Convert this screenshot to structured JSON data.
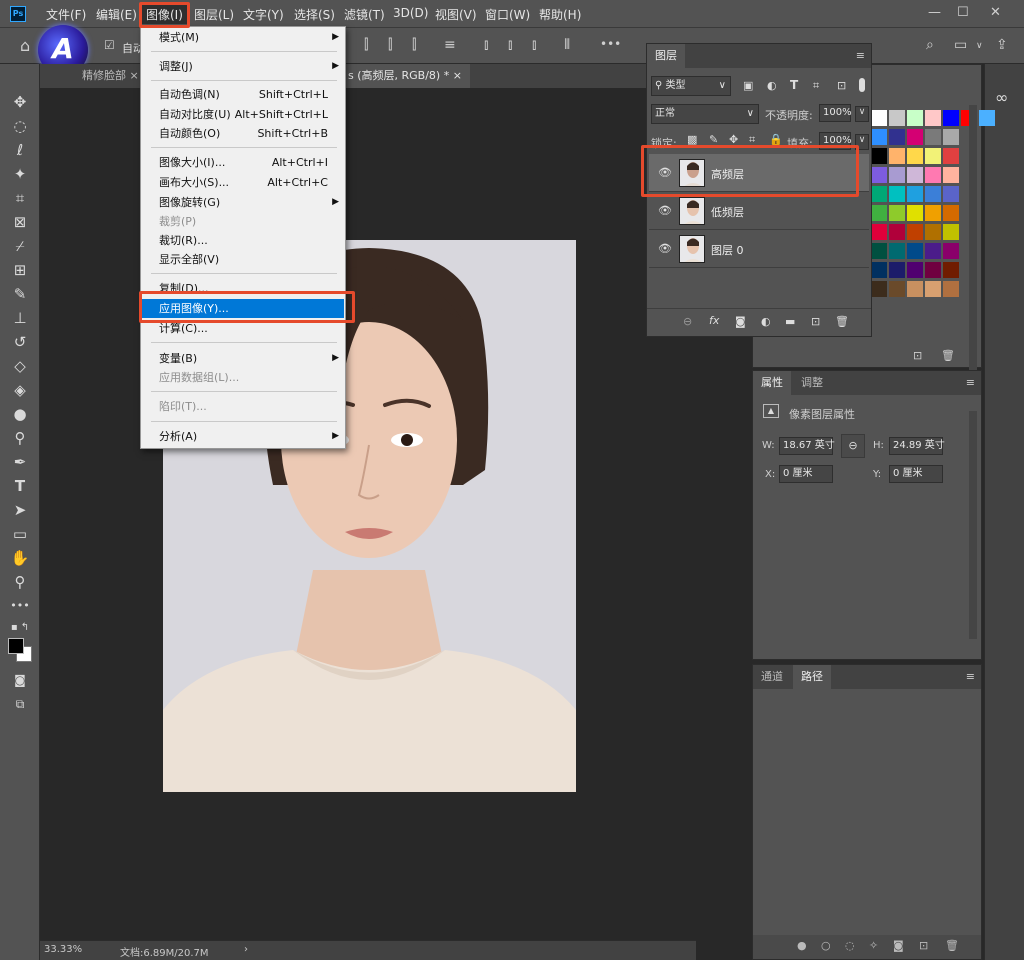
{
  "app": {
    "logo": "Ps",
    "avatar_letter": "A"
  },
  "menubar": {
    "items": [
      "文件(F)",
      "编辑(E)",
      "图像(I)",
      "图层(L)",
      "文字(Y)",
      "选择(S)",
      "滤镜(T)",
      "3D(D)",
      "视图(V)",
      "窗口(W)",
      "帮助(H)"
    ],
    "active": "图像(I)",
    "window_controls": [
      "—",
      "☐",
      "✕"
    ]
  },
  "options_bar": {
    "auto_select_label": "自动"
  },
  "tabs": [
    {
      "label": "精修脸部 ×",
      "active": false
    },
    {
      "label": "s (高频层, RGB/8) *  ×",
      "active": true
    }
  ],
  "image_menu": {
    "items": [
      {
        "label": "模式(M)",
        "shortcut": "",
        "submenu": true,
        "disabled": false
      },
      {
        "label": "调整(J)",
        "shortcut": "",
        "submenu": true,
        "disabled": false
      },
      {
        "label": "自动色调(N)",
        "shortcut": "Shift+Ctrl+L",
        "submenu": false,
        "disabled": false
      },
      {
        "label": "自动对比度(U)",
        "shortcut": "Alt+Shift+Ctrl+L",
        "submenu": false,
        "disabled": false
      },
      {
        "label": "自动颜色(O)",
        "shortcut": "Shift+Ctrl+B",
        "submenu": false,
        "disabled": false
      },
      {
        "label": "图像大小(I)...",
        "shortcut": "Alt+Ctrl+I",
        "submenu": false,
        "disabled": false
      },
      {
        "label": "画布大小(S)...",
        "shortcut": "Alt+Ctrl+C",
        "submenu": false,
        "disabled": false
      },
      {
        "label": "图像旋转(G)",
        "shortcut": "",
        "submenu": true,
        "disabled": false
      },
      {
        "label": "裁剪(P)",
        "shortcut": "",
        "submenu": false,
        "disabled": true
      },
      {
        "label": "裁切(R)...",
        "shortcut": "",
        "submenu": false,
        "disabled": false
      },
      {
        "label": "显示全部(V)",
        "shortcut": "",
        "submenu": false,
        "disabled": false
      },
      {
        "label": "复制(D)...",
        "shortcut": "",
        "submenu": false,
        "disabled": false
      },
      {
        "label": "应用图像(Y)...",
        "shortcut": "",
        "submenu": false,
        "disabled": false,
        "highlighted": true
      },
      {
        "label": "计算(C)...",
        "shortcut": "",
        "submenu": false,
        "disabled": false
      },
      {
        "label": "变量(B)",
        "shortcut": "",
        "submenu": true,
        "disabled": false
      },
      {
        "label": "应用数据组(L)...",
        "shortcut": "",
        "submenu": false,
        "disabled": true
      },
      {
        "label": "陷印(T)...",
        "shortcut": "",
        "submenu": false,
        "disabled": true
      },
      {
        "label": "分析(A)",
        "shortcut": "",
        "submenu": true,
        "disabled": false
      }
    ]
  },
  "layers_panel": {
    "title": "图层",
    "filter_label": "类型",
    "blend_mode": "正常",
    "opacity_label": "不透明度:",
    "opacity_value": "100%",
    "lock_label": "锁定:",
    "fill_label": "填充:",
    "fill_value": "100%",
    "layers": [
      {
        "name": "高频层",
        "selected": true
      },
      {
        "name": "低频层",
        "selected": false
      },
      {
        "name": "图层 0",
        "selected": false
      }
    ],
    "footer_icons": [
      "link-icon",
      "fx-icon",
      "mask-icon",
      "adjustment-icon",
      "folder-icon",
      "new-layer-icon",
      "trash-icon"
    ]
  },
  "properties_panel": {
    "tabs": [
      "属性",
      "调整"
    ],
    "section_title": "像素图层属性",
    "w_label": "W:",
    "w_value": "18.67 英寸",
    "h_label": "H:",
    "h_value": "24.89 英寸",
    "x_label": "X:",
    "x_value": "0 厘米",
    "y_label": "Y:",
    "y_value": "0 厘米"
  },
  "channels_panel": {
    "tabs": [
      "通道",
      "路径"
    ],
    "active": "路径"
  },
  "swatch_colors": [
    "#ffffff",
    "#c8c8c8",
    "#c8ffc8",
    "#ffc8c8",
    "#0000ff",
    "#ff0000",
    "#4bb0ff",
    "#2e8fff",
    "#31318f",
    "#d40073",
    "#7a7a7a",
    "#a9a9a9",
    "#000000",
    "#ffb36b",
    "#ffd84a",
    "#f2f277",
    "#e04040",
    "#7d5ce0",
    "#a89bd1",
    "#cfb7d8",
    "#ff79b1",
    "#ffb39f",
    "#00a876",
    "#00c0c0",
    "#1fa0e0",
    "#3b7fd8",
    "#5a64c9",
    "#40b040",
    "#8ecb2b",
    "#e0e000",
    "#f0a000",
    "#d46a00",
    "#e0003a",
    "#b0003a",
    "#c04000",
    "#b07000",
    "#c0c000",
    "#005040",
    "#006a70",
    "#004a8a",
    "#4b1c8a",
    "#8a006a",
    "#003060",
    "#1c1c6a",
    "#500070",
    "#700040",
    "#701c00",
    "#3c2c1c",
    "#6a4a2a",
    "#c89060",
    "#d8a070",
    "#b07040"
  ],
  "status": {
    "zoom": "33.33%",
    "doc": "文档:6.89M/20.7M"
  }
}
